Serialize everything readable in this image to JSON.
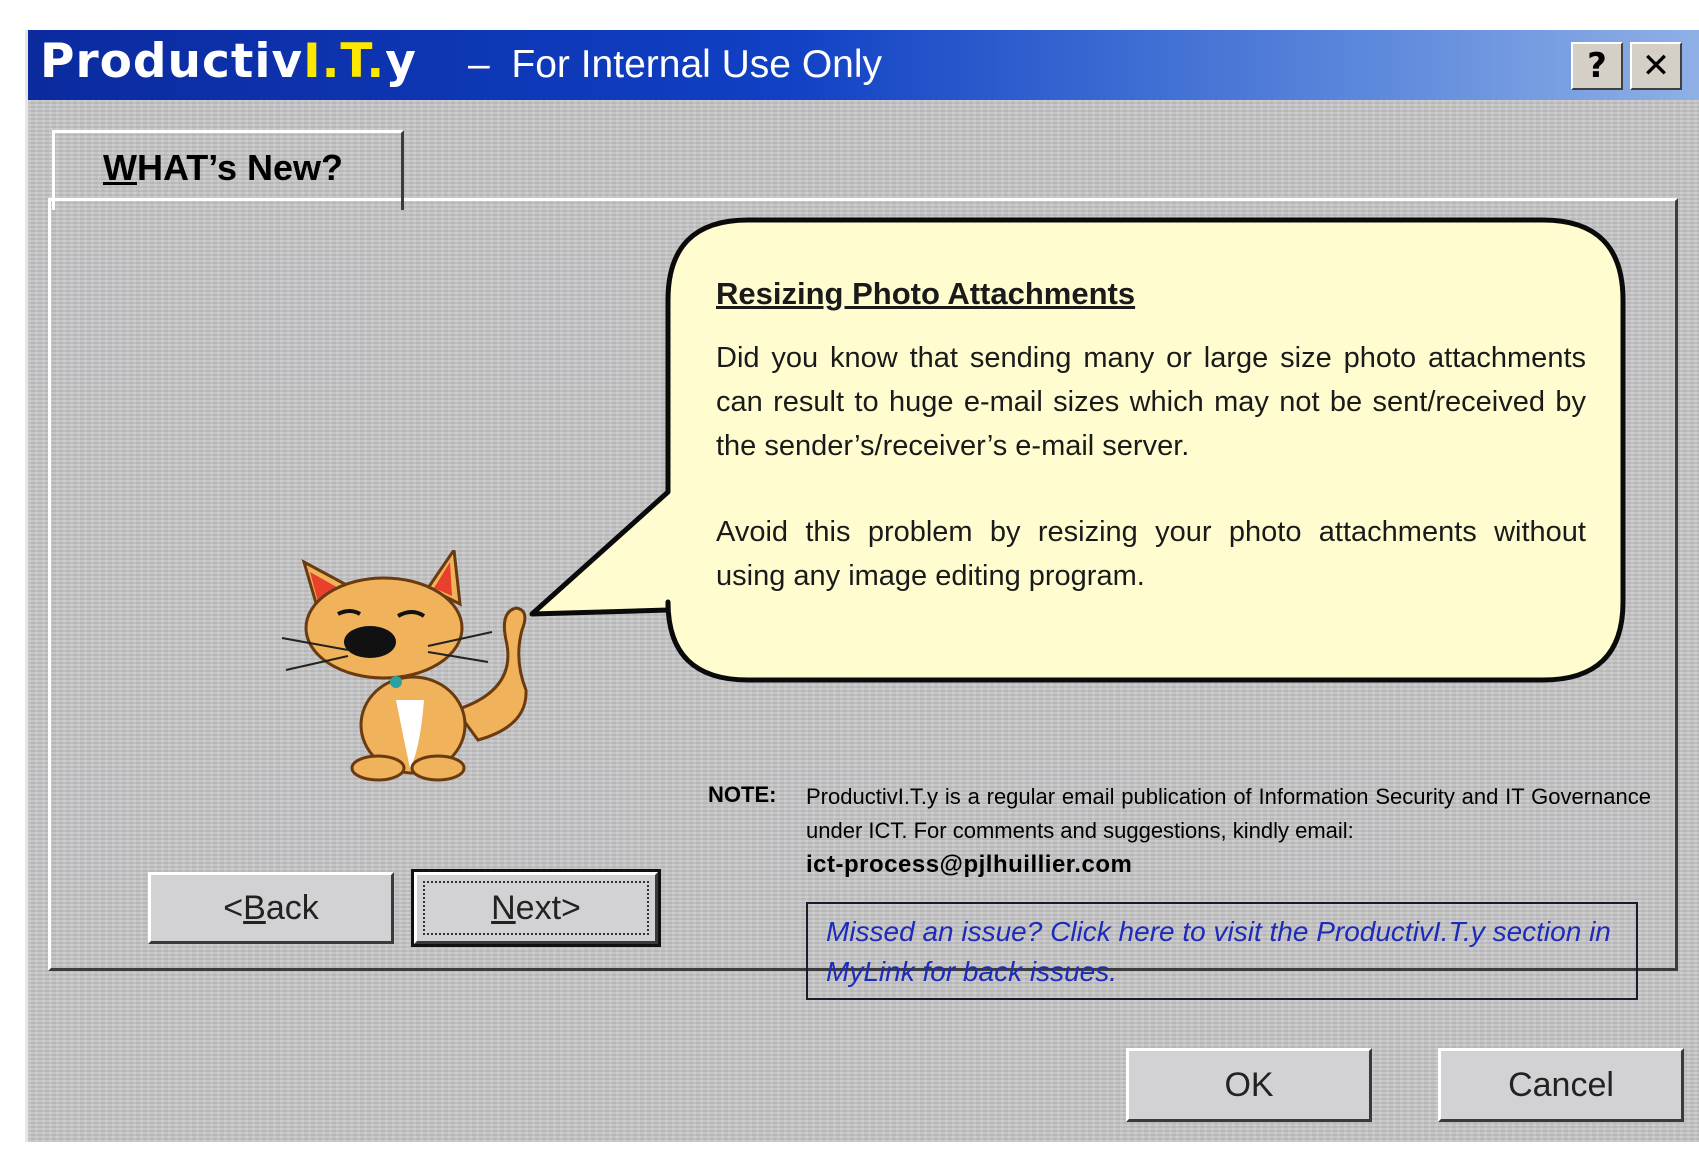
{
  "window": {
    "app_name_prefix": "Productiv",
    "app_name_highlight": "I.T.",
    "app_name_suffix": "y",
    "title_separator": "–",
    "title_text": "For Internal Use Only",
    "help_label": "?",
    "close_label": "✕"
  },
  "tab": {
    "label_first": "W",
    "label_rest": "HAT’s New?"
  },
  "bubble": {
    "title": "Resizing Photo Attachments",
    "paragraphs": [
      "Did you know that sending many or large size photo attachments can result to huge e-mail sizes which may not be sent/received by the sender’s/receiver’s e-mail server.",
      "Avoid this problem by resizing your photo attachments without using any image editing program."
    ],
    "fill_color": "#fffdd0"
  },
  "note": {
    "label": "NOTE:",
    "text": "ProductivI.T.y is a regular email publication of Information Security and IT Governance under ICT. For comments and suggestions, kindly email:",
    "email": "ict-process@pjlhuillier.com"
  },
  "link": {
    "text": "Missed an issue? Click here to visit the ProductivI.T.y section in MyLink for back issues."
  },
  "nav": {
    "back_prefix": "<",
    "back_underlined": "B",
    "back_rest": "ack",
    "next_prefix": "",
    "next_underlined": "N",
    "next_rest": "ext>"
  },
  "footer": {
    "ok_label": "OK",
    "cancel_label": "Cancel"
  },
  "colors": {
    "title_bar_start": "#0b2a9e",
    "title_bar_end": "#8fb0e6",
    "app_name_highlight": "#ffe800",
    "dialog_bg": "#c4c4c6",
    "link_text": "#1d2bb8"
  },
  "icons": {
    "mascot": "cartoon-cat-icon"
  }
}
